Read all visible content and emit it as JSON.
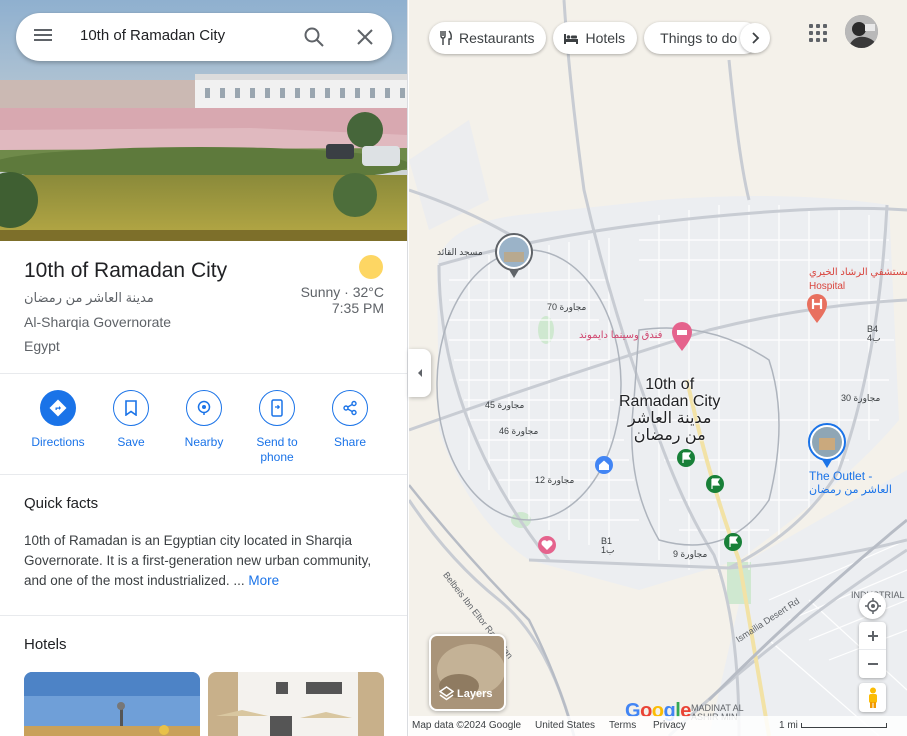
{
  "search": {
    "query": "10th of Ramadan City"
  },
  "place": {
    "name": "10th of Ramadan City",
    "name_arabic": "مدينة العاشر من رمضان",
    "region": "Al-Sharqia Governorate",
    "country": "Egypt",
    "weather": {
      "condition": "Sunny · 32°C",
      "time": "7:35 PM"
    }
  },
  "actions": [
    {
      "label": "Directions",
      "icon": "directions-icon"
    },
    {
      "label": "Save",
      "icon": "bookmark-icon"
    },
    {
      "label": "Nearby",
      "icon": "nearby-icon"
    },
    {
      "label": "Send to phone",
      "icon": "send-to-phone-icon"
    },
    {
      "label": "Share",
      "icon": "share-icon"
    }
  ],
  "quick_facts": {
    "heading": "Quick facts",
    "text": "10th of Ramadan is an Egyptian city located in Sharqia Governorate. It is a first-generation new urban community, and one of the most industrialized. ...",
    "more": "More"
  },
  "hotels": {
    "heading": "Hotels"
  },
  "map": {
    "chips": [
      {
        "label": "Restaurants",
        "icon": "fork-knife-icon"
      },
      {
        "label": "Hotels",
        "icon": "bed-icon"
      },
      {
        "label": "Things to do",
        "icon": "camera-icon"
      }
    ],
    "city_label_en_1": "10th of",
    "city_label_en_2": "Ramadan City",
    "city_label_ar_1": "مدينة العاشر",
    "city_label_ar_2": "من رمضان",
    "labels": {
      "mosque": "مسجد القائد",
      "hotel": "فندق وسينما دايموند",
      "hospital_ar": "مستشفي الرشاد الخيري",
      "hospital_en": "Hospital",
      "outlet_en": "The Outlet -",
      "outlet_ar": "العاشر من رمضان",
      "district_70": "مجاورة 70",
      "district_45": "مجاورة 45",
      "district_46": "مجاورة 46",
      "district_12": "مجاورة 12",
      "district_9": "مجاورة 9",
      "district_30": "مجاورة 30",
      "b1": "B1",
      "b1_ar": "ب1",
      "b4": "B4",
      "b4_ar": "ب4",
      "road_bilbeis": "Belbeis Ibn Eltor Ramadan",
      "road_ismailia": "Ismailia Desert Rd",
      "industrial": "INDUSTRIAL",
      "madinat_1": "MADINAT AL",
      "madinat_2": "ASHIR MIN"
    },
    "layers_label": "Layers",
    "google_logo": "Google",
    "footer": {
      "map_data": "Map data ©2024 Google",
      "country": "United States",
      "terms": "Terms",
      "privacy": "Privacy",
      "scale": "1 mi"
    }
  }
}
